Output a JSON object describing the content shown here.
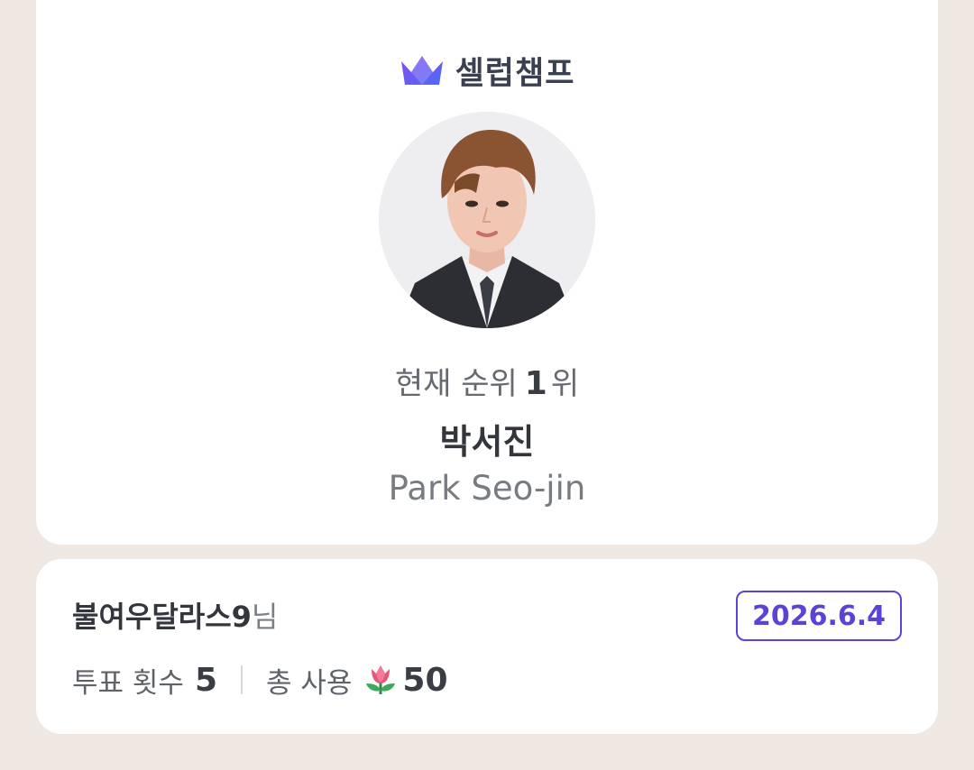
{
  "brand": {
    "name": "셀럽챔프",
    "logo_icon": "crown-icon",
    "colors": [
      "#7B4BF0",
      "#4A74F5"
    ]
  },
  "celebrity": {
    "rank_prefix": "현재 순위",
    "rank_number": "1",
    "rank_suffix": "위",
    "name_korean": "박서진",
    "name_english": "Park Seo-jin"
  },
  "vote_summary": {
    "voter_name": "불여우달라스9",
    "voter_suffix": "님",
    "date": "2026.6.4",
    "vote_count_label": "투표 횟수",
    "vote_count": "5",
    "total_used_label": "총 사용",
    "total_used_icon": "tulip-icon",
    "total_used": "50"
  },
  "colors": {
    "page_background": "#EFE8E2",
    "card_background": "#FFFFFF",
    "accent": "#5B43D6"
  }
}
